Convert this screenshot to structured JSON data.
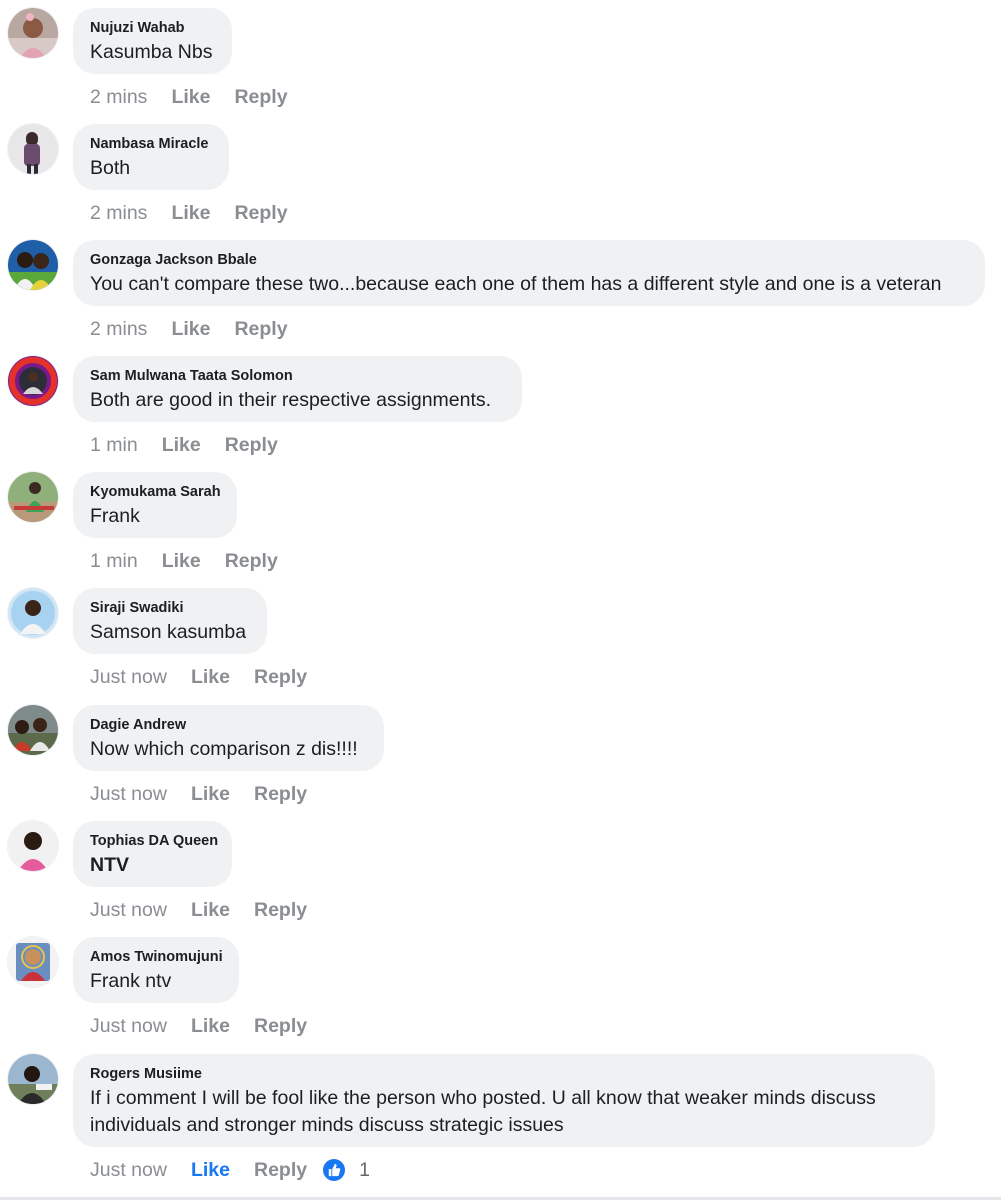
{
  "comments": [
    {
      "author": "Nujuzi Wahab",
      "text": "Kasumba Nbs",
      "time": "2 mins",
      "like_label": "Like",
      "reply_label": "Reply",
      "avatar_icon": "girl-portrait-avatar"
    },
    {
      "author": "Nambasa Miracle",
      "text": "Both",
      "time": "2 mins",
      "like_label": "Like",
      "reply_label": "Reply",
      "avatar_icon": "person-standing-avatar"
    },
    {
      "author": "Gonzaga Jackson Bbale",
      "text": "You can't compare these two...because each one of them has a different style and one is a veteran",
      "time": "2 mins",
      "like_label": "Like",
      "reply_label": "Reply",
      "avatar_icon": "couple-avatar"
    },
    {
      "author": "Sam Mulwana Taata Solomon",
      "text": "Both are good in their respective assignments.",
      "time": "1 min",
      "like_label": "Like",
      "reply_label": "Reply",
      "avatar_icon": "badge-frame-avatar"
    },
    {
      "author": "Kyomukama Sarah",
      "text": "Frank",
      "time": "1 min",
      "like_label": "Like",
      "reply_label": "Reply",
      "avatar_icon": "outdoor-person-avatar"
    },
    {
      "author": "Siraji Swadiki",
      "text": "Samson kasumba",
      "time": "Just now",
      "like_label": "Like",
      "reply_label": "Reply",
      "avatar_icon": "man-portrait-avatar"
    },
    {
      "author": "Dagie Andrew",
      "text": "Now which comparison z dis!!!!",
      "time": "Just now",
      "like_label": "Like",
      "reply_label": "Reply",
      "avatar_icon": "group-photo-avatar"
    },
    {
      "author": "Tophias DA Queen",
      "text": "NTV",
      "time": "Just now",
      "like_label": "Like",
      "reply_label": "Reply",
      "avatar_icon": "woman-portrait-avatar"
    },
    {
      "author": "Amos Twinomujuni",
      "text": "Frank ntv",
      "time": "Just now",
      "like_label": "Like",
      "reply_label": "Reply",
      "avatar_icon": "religious-image-avatar"
    },
    {
      "author": "Rogers Musiime",
      "text": "If i comment I will be fool like the person  who posted. U all know that  weaker minds discuss individuals and stronger minds discuss strategic issues",
      "time": "Just now",
      "like_label": "Like",
      "reply_label": "Reply",
      "avatar_icon": "man-outdoor-avatar",
      "reaction_icon": "thumbs-up-icon",
      "reaction_count": "1"
    }
  ],
  "colors": {
    "bubble": "#eff1f3",
    "meta_text": "#8a8d91",
    "active_like": "#1877f2"
  }
}
